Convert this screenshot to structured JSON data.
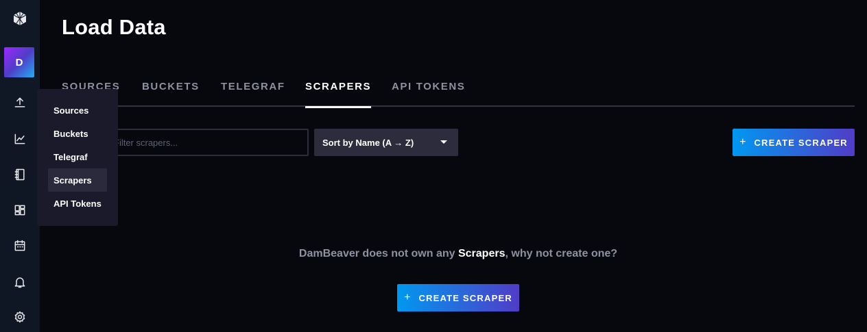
{
  "nav": {
    "logo_icon": "influx-cube-icon",
    "avatar_letter": "D",
    "icons": [
      "upload-icon",
      "graph-icon",
      "notebook-icon",
      "dashboards-icon",
      "calendar-icon",
      "bell-icon",
      "gear-icon"
    ]
  },
  "flyout": {
    "items": [
      "Sources",
      "Buckets",
      "Telegraf",
      "Scrapers",
      "API Tokens"
    ],
    "active": "Scrapers"
  },
  "page": {
    "title": "Load Data"
  },
  "tabs": [
    "SOURCES",
    "BUCKETS",
    "TELEGRAF",
    "SCRAPERS",
    "API TOKENS"
  ],
  "active_tab": "SCRAPERS",
  "search": {
    "placeholder": "Filter scrapers..."
  },
  "sort": {
    "value": "Sort by Name (A → Z)"
  },
  "create_button": {
    "plus": "+",
    "label": "CREATE SCRAPER"
  },
  "empty_state": {
    "prefix": "DamBeaver does not own any ",
    "highlight": "Scrapers",
    "suffix": ", why not create one?"
  },
  "colors": {
    "accent_start": "#0098f0",
    "accent_end": "#513cc6",
    "background": "#07070e"
  }
}
